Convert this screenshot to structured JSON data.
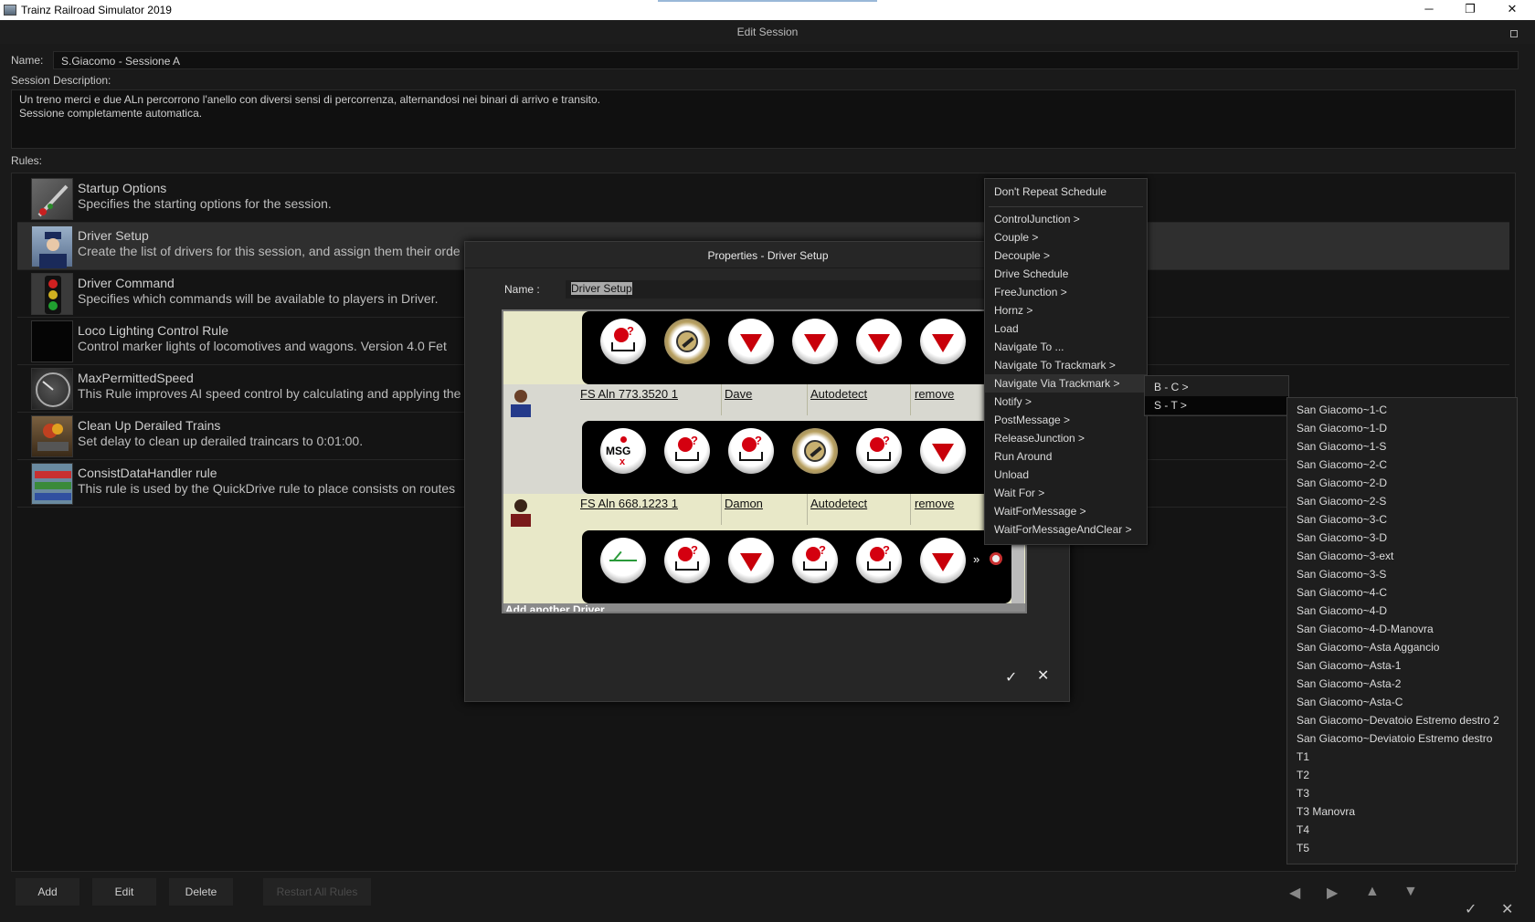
{
  "window": {
    "title": "Trainz Railroad Simulator 2019",
    "minimize": "─",
    "maximize": "❐",
    "close": "✕"
  },
  "header": {
    "title": "Edit Session"
  },
  "session": {
    "name_label": "Name:",
    "name_value": "S.Giacomo - Sessione A",
    "desc_label": "Session Description:",
    "desc_line1": "Un treno merci e due ALn percorrono  l'anello con diversi sensi di percorrenza, alternandosi nei binari di arrivo e transito.",
    "desc_line2": "Sessione completamente automatica.",
    "rules_label": "Rules:"
  },
  "rules": [
    {
      "name": "Startup Options",
      "desc": "Specifies the starting options for the session."
    },
    {
      "name": "Driver Setup",
      "desc": "Create the list of drivers for this session, and assign them their orde"
    },
    {
      "name": "Driver Command",
      "desc": "Specifies which commands will be available to players in Driver."
    },
    {
      "name": "Loco Lighting Control Rule",
      "desc": "Control marker lights of locomotives and wagons. Version 4.0 Fet"
    },
    {
      "name": "MaxPermittedSpeed",
      "desc": "This Rule improves AI speed control by calculating and applying the"
    },
    {
      "name": "Clean Up Derailed Trains",
      "desc": "Set delay to clean up derailed traincars to 0:01:00."
    },
    {
      "name": "ConsistDataHandler rule",
      "desc": "This rule is used by the QuickDrive rule to place consists on routes"
    }
  ],
  "bottom": {
    "add": "Add",
    "edit": "Edit",
    "delete": "Delete",
    "restart": "Restart All Rules",
    "ok": "✓",
    "cancel": "✕"
  },
  "dialog": {
    "title": "Properties - Driver Setup",
    "name_label": "Name :",
    "name_value": "Driver Setup",
    "drivers": [
      {
        "train": "FS Aln 773.3520 1",
        "driver": "Dave",
        "mode": "Autodetect",
        "remove": "remove"
      },
      {
        "train": "FS Aln 668.1223 1",
        "driver": "Damon",
        "mode": "Autodetect",
        "remove": "remove"
      }
    ],
    "add_driver": "Add another Driver",
    "ok": "✓",
    "cancel": "✕"
  },
  "menu": {
    "items": [
      "Don't Repeat Schedule",
      "ControlJunction >",
      "Couple >",
      "Decouple >",
      "Drive Schedule",
      "FreeJunction >",
      "Hornz >",
      "Load",
      "Navigate To ...",
      "Navigate To Trackmark >",
      "Navigate Via Trackmark >",
      "Notify >",
      "PostMessage >",
      "ReleaseJunction >",
      "Run Around",
      "Unload",
      "Wait For >",
      "WaitForMessage >",
      "WaitForMessageAndClear >"
    ],
    "highlighted": "Navigate Via Trackmark >"
  },
  "submenu1": {
    "items": [
      "B - C >",
      "S - T >"
    ],
    "highlighted": "S - T >"
  },
  "submenu2": {
    "items": [
      "San Giacomo~1-C",
      "San Giacomo~1-D",
      "San Giacomo~1-S",
      "San Giacomo~2-C",
      "San Giacomo~2-D",
      "San Giacomo~2-S",
      "San Giacomo~3-C",
      "San Giacomo~3-D",
      "San Giacomo~3-ext",
      "San Giacomo~3-S",
      "San Giacomo~4-C",
      "San Giacomo~4-D",
      "San Giacomo~4-D-Manovra",
      "San Giacomo~Asta Aggancio",
      "San Giacomo~Asta-1",
      "San Giacomo~Asta-2",
      "San Giacomo~Asta-C",
      "San Giacomo~Devatoio Estremo destro 2",
      "San Giacomo~Deviatoio Estremo destro",
      "T1",
      "T2",
      "T3",
      "T3 Manovra",
      "T4",
      "T5"
    ]
  }
}
